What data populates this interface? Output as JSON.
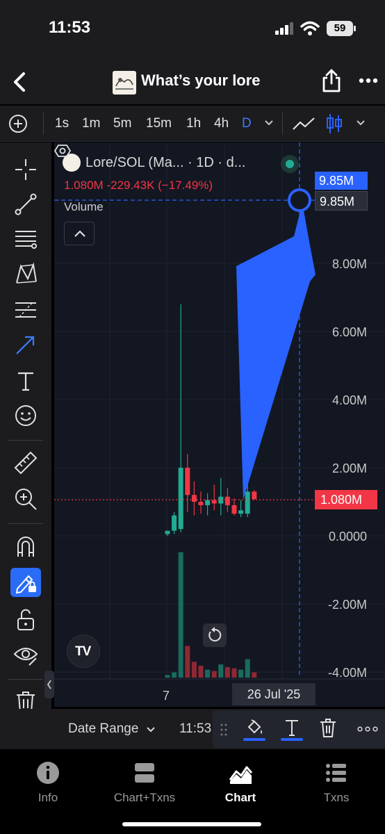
{
  "status_bar": {
    "time": "11:53",
    "battery": "59"
  },
  "header": {
    "title": "What’s your lore"
  },
  "toolbar": {
    "timeframes": [
      "1s",
      "1m",
      "5m",
      "15m",
      "1h",
      "4h",
      "D"
    ],
    "active_timeframe": "D"
  },
  "chart": {
    "legend_name": "Lore/SOL (Ma... · 1D · d...",
    "legend_values": "1.080M  -229.43K (−17.49%)",
    "volume_label": "Volume",
    "price_axis": [
      "8.00M",
      "6.00M",
      "4.00M",
      "2.00M",
      "0.0000",
      "-2.00M",
      "-4.00M"
    ],
    "crosshair_price_blue": "9.85M",
    "crosshair_price_gray": "9.85M",
    "last_price": "1.080M",
    "x_label": "7",
    "date_tag": "26 Jul '25",
    "colors": {
      "up": "#22ab94",
      "down": "#f23645",
      "drawing": "#2962ff",
      "background": "#131722"
    }
  },
  "chart_data": {
    "type": "candlestick",
    "title": "Lore/SOL (Ma... · 1D · d...",
    "ylim": [
      -4.2,
      10.5
    ],
    "y_unit": "M",
    "candles": [
      {
        "o": 0.05,
        "h": 0.15,
        "l": 0.0,
        "c": 0.15
      },
      {
        "o": 0.15,
        "h": 0.7,
        "l": 0.05,
        "c": 0.6
      },
      {
        "o": 0.2,
        "h": 6.8,
        "l": 0.1,
        "c": 2.0
      },
      {
        "o": 2.0,
        "h": 2.4,
        "l": 0.7,
        "c": 1.2
      },
      {
        "o": 1.2,
        "h": 1.6,
        "l": 0.6,
        "c": 1.0
      },
      {
        "o": 1.0,
        "h": 1.3,
        "l": 0.65,
        "c": 0.9
      },
      {
        "o": 0.9,
        "h": 1.25,
        "l": 0.6,
        "c": 1.05
      },
      {
        "o": 1.05,
        "h": 1.5,
        "l": 0.75,
        "c": 0.95
      },
      {
        "o": 0.95,
        "h": 1.7,
        "l": 0.6,
        "c": 1.15
      },
      {
        "o": 1.15,
        "h": 1.4,
        "l": 0.7,
        "c": 0.9
      },
      {
        "o": 0.9,
        "h": 1.1,
        "l": 0.6,
        "c": 0.65
      },
      {
        "o": 0.65,
        "h": 1.05,
        "l": 0.55,
        "c": 0.75
      },
      {
        "o": 0.65,
        "h": 2.1,
        "l": 0.55,
        "c": 1.3
      },
      {
        "o": 1.3,
        "h": 1.35,
        "l": 1.05,
        "c": 1.08
      }
    ],
    "volumes": [
      {
        "v": 0.2,
        "up": true
      },
      {
        "v": 0.4,
        "up": true
      },
      {
        "v": 9.5,
        "up": true
      },
      {
        "v": 2.4,
        "up": false
      },
      {
        "v": 1.2,
        "up": false
      },
      {
        "v": 0.9,
        "up": false
      },
      {
        "v": 0.6,
        "up": true
      },
      {
        "v": 0.5,
        "up": false
      },
      {
        "v": 1.0,
        "up": true
      },
      {
        "v": 0.8,
        "up": false
      },
      {
        "v": 0.7,
        "up": false
      },
      {
        "v": 0.6,
        "up": true
      },
      {
        "v": 1.4,
        "up": true
      },
      {
        "v": 0.4,
        "up": false
      }
    ]
  },
  "bottom_bar": {
    "date_range": "Date Range",
    "time": "11:53"
  },
  "tabs": [
    {
      "label": "Info",
      "icon": "info-icon"
    },
    {
      "label": "Chart+Txns",
      "icon": "chart-txns-icon"
    },
    {
      "label": "Chart",
      "icon": "chart-icon",
      "active": true
    },
    {
      "label": "Txns",
      "icon": "txns-icon"
    }
  ]
}
